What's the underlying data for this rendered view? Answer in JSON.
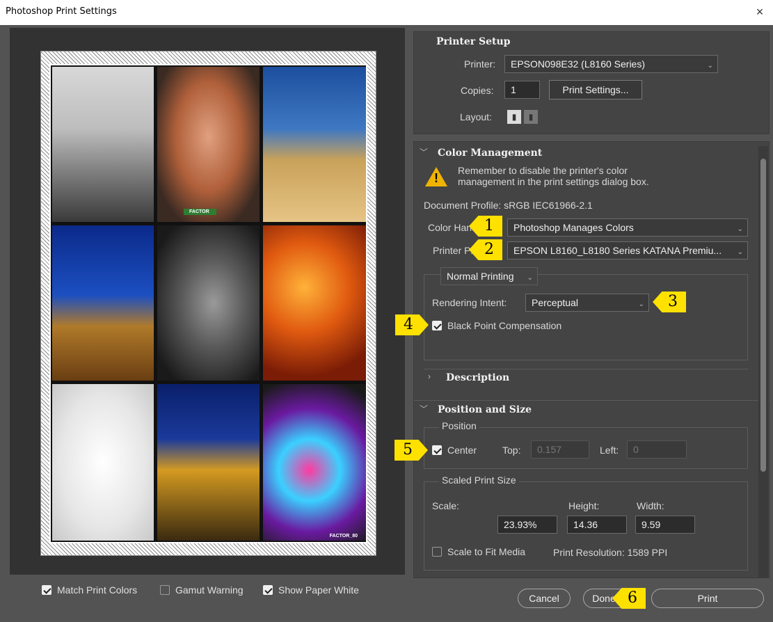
{
  "window": {
    "title": "Photoshop Print Settings",
    "close": "×"
  },
  "preview": {
    "paper_size": "10.16 cm x 15.24 cm",
    "caption1": "FACTOR",
    "caption2": "FACTOR_80"
  },
  "preview_options": {
    "match_print_colors": {
      "label": "Match Print Colors",
      "checked": true
    },
    "gamut_warning": {
      "label": "Gamut Warning",
      "checked": false
    },
    "show_paper_white": {
      "label": "Show Paper White",
      "checked": true
    }
  },
  "printer_setup": {
    "title": "Printer Setup",
    "printer_label": "Printer:",
    "printer_value": "EPSON098E32 (L8160 Series)",
    "copies_label": "Copies:",
    "copies_value": "1",
    "print_settings_button": "Print Settings...",
    "layout_label": "Layout:"
  },
  "color_management": {
    "title": "Color Management",
    "warning": "Remember to disable the printer's color management in the print settings dialog box.",
    "document_profile": "Document Profile: sRGB IEC61966-2.1",
    "color_handling_label": "Color Hand",
    "color_handling_value": "Photoshop Manages Colors",
    "printer_profile_label": "Printer Pro",
    "printer_profile_value": "EPSON  L8160_L8180  Series  KATANA  Premiu...",
    "mode_value": "Normal Printing",
    "rendering_intent_label": "Rendering Intent:",
    "rendering_intent_value": "Perceptual",
    "black_point_label": "Black Point Compensation",
    "black_point_checked": true
  },
  "description": {
    "title": "Description"
  },
  "position_size": {
    "title": "Position and Size",
    "position_group": "Position",
    "center_label": "Center",
    "center_checked": true,
    "top_label": "Top:",
    "top_value": "0.157",
    "left_label": "Left:",
    "left_value": "0",
    "scaled_group": "Scaled Print Size",
    "scale_label": "Scale:",
    "scale_value": "23.93%",
    "height_label": "Height:",
    "height_value": "14.36",
    "width_label": "Width:",
    "width_value": "9.59",
    "scale_to_fit_label": "Scale to Fit Media",
    "scale_to_fit_checked": false,
    "print_resolution": "Print Resolution: 1589 PPI"
  },
  "buttons": {
    "cancel": "Cancel",
    "done": "Done",
    "print": "Print"
  },
  "badges": [
    "1",
    "2",
    "3",
    "4",
    "5",
    "6"
  ],
  "colors": {
    "dialog_bg": "#535353",
    "panel_bg": "#444444",
    "badge": "#ffe100",
    "warning": "#f0b400"
  }
}
